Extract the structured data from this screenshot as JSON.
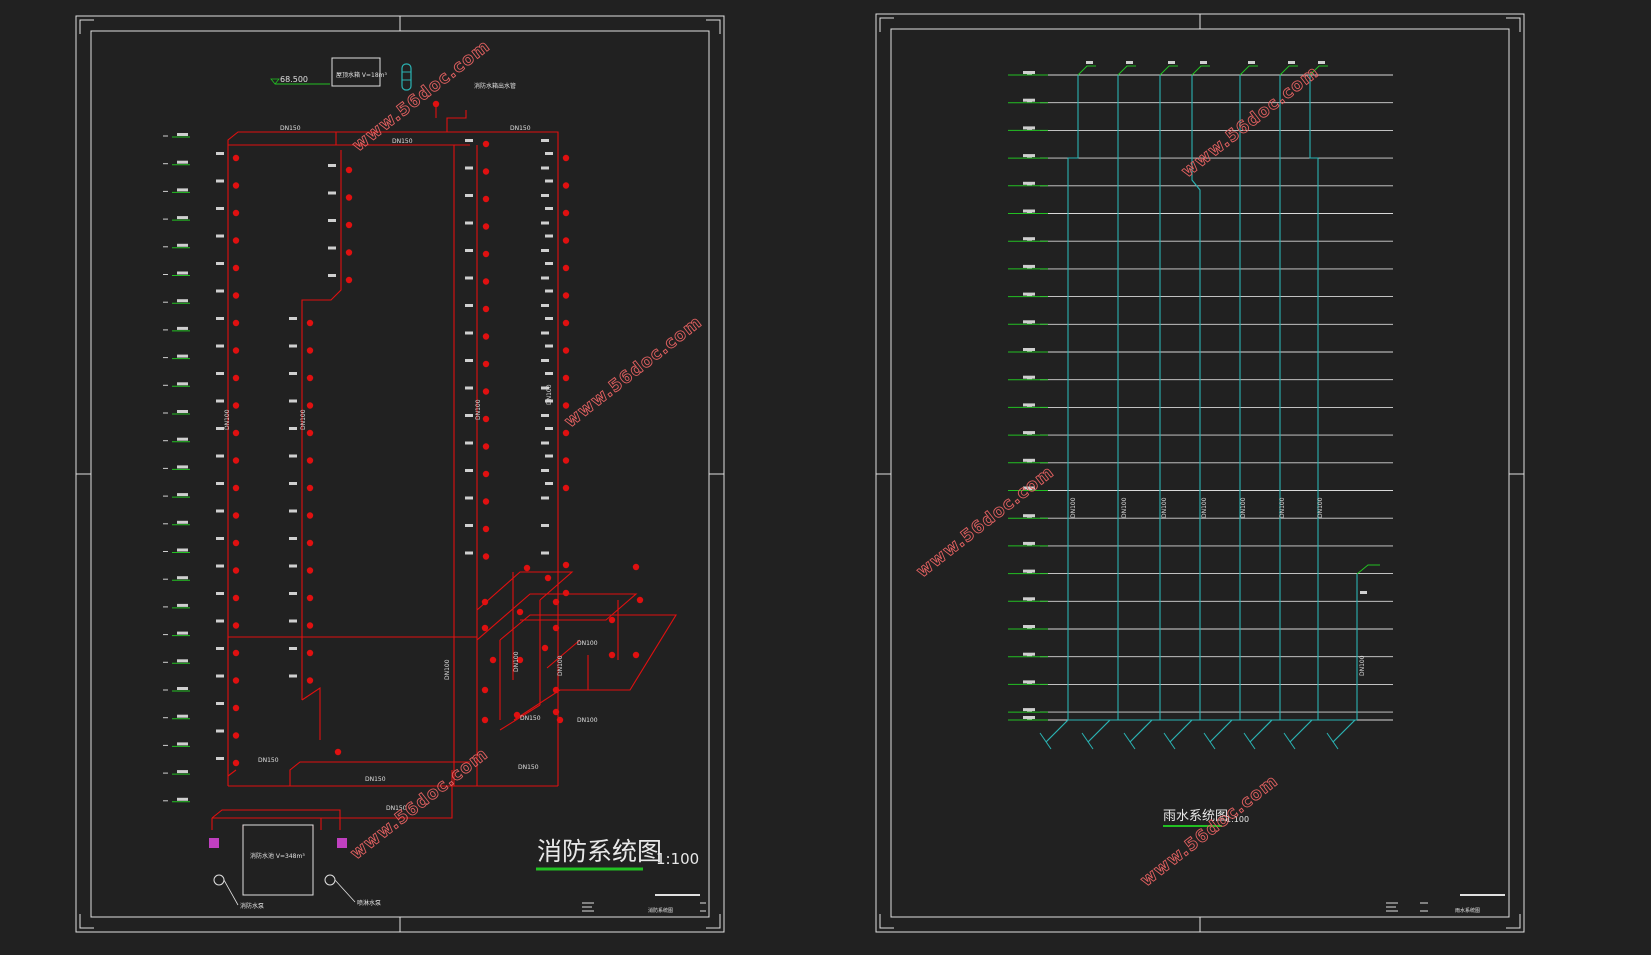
{
  "fire_system": {
    "title": "消防系统图",
    "scale": "1:100",
    "top_level_label": "68.500",
    "top_tank_label": "屋顶水箱 V=18m³",
    "top_note": "消防水箱出水管",
    "pipe_labels": {
      "top_left": "DN150",
      "top_mid": "DN150",
      "top_right": "DN150",
      "riser_a": "DN100",
      "riser_b": "DN100",
      "riser_c": "DN100",
      "riser_d": "DN100",
      "riser_e": "DN100",
      "bottom_left": "DN150",
      "bottom_mid": "DN150",
      "bottom_right": "DN150",
      "pump_outlet": "DN150",
      "branch_a": "DN100",
      "branch_b": "DN100",
      "branch_c": "DN100",
      "branch_d": "DN150",
      "branch_e": "DN100"
    },
    "pool_label": "消防水池 V=348m³",
    "pump_label_left": "消防水泵",
    "pump_label_right": "喷淋水泵",
    "title_block_name": "消防系统图"
  },
  "rain_system": {
    "title": "雨水系统图",
    "scale": "1:100",
    "riser_labels": [
      "DN100",
      "DN100",
      "DN100",
      "DN100",
      "DN100",
      "DN100",
      "DN100"
    ],
    "side_riser_label": "DN100",
    "title_block_name": "雨水系统图"
  },
  "watermark": "www.56doc.com",
  "colors": {
    "background": "#212121",
    "frame": "#e0e0e0",
    "fire_pipe": "#e01010",
    "rain_pipe": "#2ab3b3",
    "floor_line": "#d8d8d8",
    "level_green": "#22c022",
    "pump_magenta": "#c040c0"
  }
}
